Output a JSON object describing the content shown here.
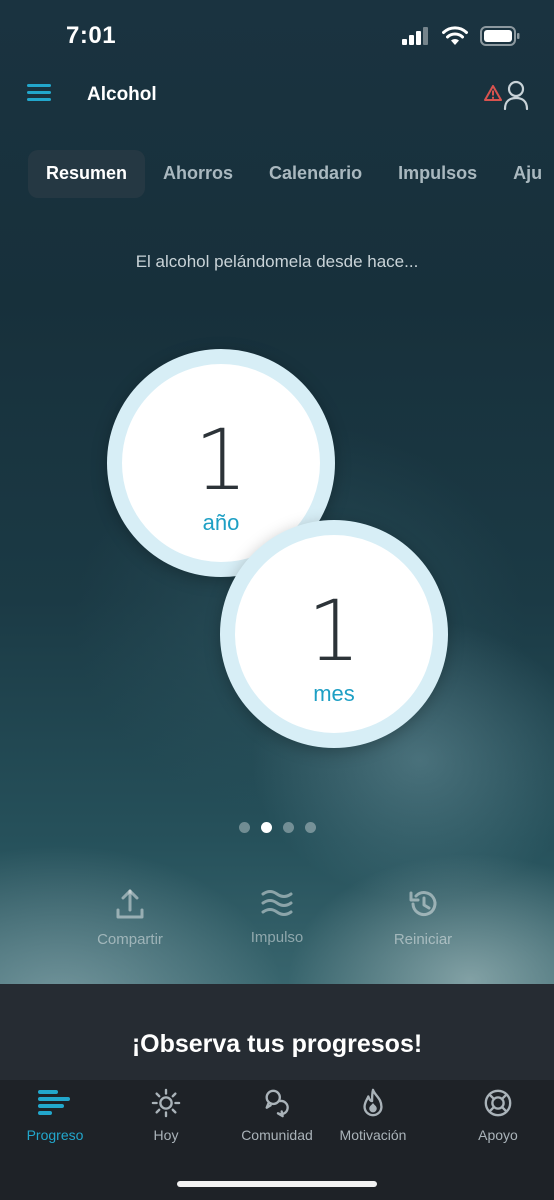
{
  "status_bar": {
    "time": "7:01"
  },
  "header": {
    "title": "Alcohol"
  },
  "tabs": [
    {
      "label": "Resumen",
      "active": true
    },
    {
      "label": "Ahorros",
      "active": false
    },
    {
      "label": "Calendario",
      "active": false
    },
    {
      "label": "Impulsos",
      "active": false
    },
    {
      "label": "Aju",
      "active": false
    }
  ],
  "subtitle": "El alcohol pelándomela desde hace...",
  "counters": [
    {
      "value": "1",
      "unit": "año"
    },
    {
      "value": "1",
      "unit": "mes"
    }
  ],
  "page_indicator": {
    "total": 4,
    "current": 2
  },
  "actions": {
    "share": "Compartir",
    "urge": "Impulso",
    "reset": "Reiniciar"
  },
  "banner": {
    "text": "¡Observa tus progresos!"
  },
  "bottom_nav": [
    {
      "label": "Progreso",
      "icon": "progress-bars-icon",
      "active": true
    },
    {
      "label": "Hoy",
      "icon": "sun-icon",
      "active": false
    },
    {
      "label": "Comunidad",
      "icon": "community-bubbles-icon",
      "active": false
    },
    {
      "label": "Motivación",
      "icon": "flame-icon",
      "active": false
    },
    {
      "label": "Apoyo",
      "icon": "lifebuoy-icon",
      "active": false
    }
  ],
  "colors": {
    "accent": "#22a7cc",
    "alert": "#d9534f",
    "counter_ring": "#d7eef6",
    "nav_background": "#1e2227",
    "banner_background": "#262c33"
  }
}
